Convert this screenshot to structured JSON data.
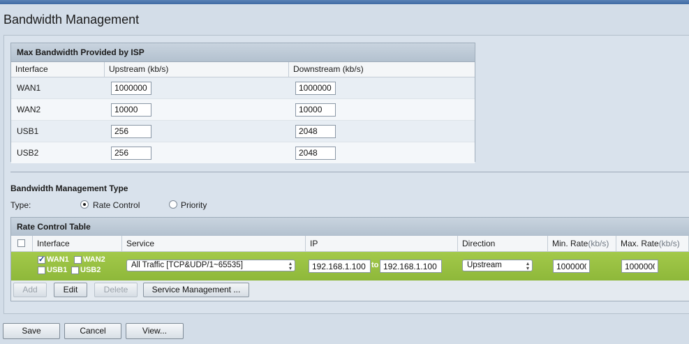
{
  "page": {
    "title": "Bandwidth Management"
  },
  "isp": {
    "title": "Max Bandwidth Provided by ISP",
    "columns": [
      "Interface",
      "Upstream (kb/s)",
      "Downstream (kb/s)"
    ],
    "rows": [
      {
        "interface": "WAN1",
        "upstream": "1000000",
        "downstream": "1000000"
      },
      {
        "interface": "WAN2",
        "upstream": "10000",
        "downstream": "10000"
      },
      {
        "interface": "USB1",
        "upstream": "256",
        "downstream": "2048"
      },
      {
        "interface": "USB2",
        "upstream": "256",
        "downstream": "2048"
      }
    ]
  },
  "bm_type": {
    "title": "Bandwidth Management Type",
    "type_label": "Type:",
    "options": [
      {
        "label": "Rate Control",
        "selected": true
      },
      {
        "label": "Priority",
        "selected": false
      }
    ]
  },
  "rate_table": {
    "title": "Rate Control Table",
    "columns": {
      "interface": "Interface",
      "service": "Service",
      "ip": "IP",
      "direction": "Direction",
      "min_rate": "Min. Rate",
      "min_rate_unit": "(kb/s)",
      "max_rate": "Max. Rate",
      "max_rate_unit": "(kb/s)"
    },
    "row": {
      "interfaces": [
        {
          "label": "WAN1",
          "checked": true
        },
        {
          "label": "WAN2",
          "checked": false
        },
        {
          "label": "USB1",
          "checked": false
        },
        {
          "label": "USB2",
          "checked": false
        }
      ],
      "service": "All Traffic [TCP&UDP/1~65535]",
      "ip_from": "192.168.1.100",
      "ip_to_label": "to",
      "ip_to": "192.168.1.100",
      "direction": "Upstream",
      "min_rate": "1000000",
      "max_rate": "1000000"
    },
    "buttons": {
      "add": "Add",
      "edit": "Edit",
      "delete": "Delete",
      "service_mgmt": "Service Management ..."
    }
  },
  "footer": {
    "save": "Save",
    "cancel": "Cancel",
    "view": "View..."
  }
}
